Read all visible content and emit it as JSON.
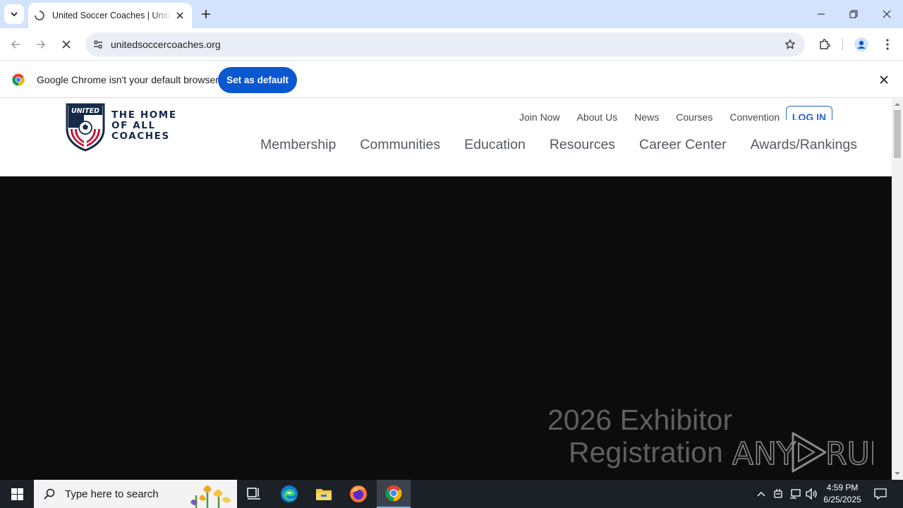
{
  "browser": {
    "tab_title": "United Soccer Coaches | Uniting the Soccer Coaching Community",
    "url": "unitedsoccercoaches.org",
    "infobar_text": "Google Chrome isn't your default browser",
    "set_default_label": "Set as default"
  },
  "site": {
    "tagline": [
      "THE HOME",
      "OF ALL",
      "COACHES"
    ],
    "utility_nav": [
      "Join Now",
      "About Us",
      "News",
      "Courses",
      "Convention"
    ],
    "login_label": "LOG IN",
    "main_nav": [
      "Membership",
      "Communities",
      "Education",
      "Resources",
      "Career Center",
      "Awards/Rankings"
    ],
    "hero_line1": "2026 Exhibitor",
    "hero_line2": "Registration"
  },
  "watermark": "ANY RUN",
  "taskbar": {
    "search_placeholder": "Type here to search",
    "time": "4:59 PM",
    "date": "6/25/2025"
  },
  "colors": {
    "tabstrip": "#d3e3fd",
    "primary_button": "#0b57d0",
    "brand_navy": "#15294a",
    "brand_red": "#c8102e",
    "hero_bg": "#0c0c0c"
  }
}
